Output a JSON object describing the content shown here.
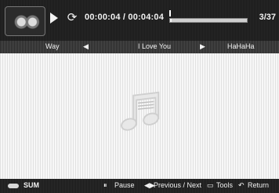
{
  "player": {
    "elapsed": "00:00:04",
    "separator": "/",
    "duration": "00:04:04",
    "time_display": "00:00:04 / 00:04:04",
    "progress_fraction": 0.016,
    "page_count": "3/37"
  },
  "tracks": {
    "previous": "Way",
    "current": "I Love You",
    "next": "HaHaHa"
  },
  "help_bar": {
    "sum_label": "SUM",
    "pause_label": "Pause",
    "prevnext_label": "Previous / Next",
    "tools_label": "Tools",
    "return_label": "Return"
  },
  "icons": {
    "album_art": "album-art-icon",
    "play": "play-icon",
    "repeat": "repeat-icon",
    "music": "music-note-icon",
    "prev_arrow": "left-arrow-icon",
    "next_arrow": "right-arrow-icon",
    "pause": "pause-key-icon",
    "prevnext": "left-right-key-icon",
    "tools": "tools-icon",
    "return": "return-icon"
  }
}
